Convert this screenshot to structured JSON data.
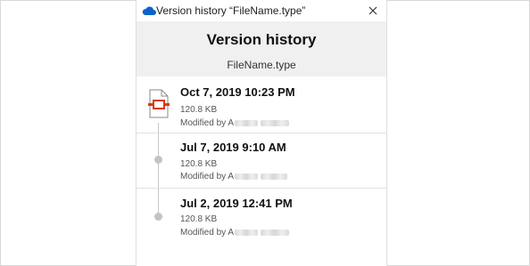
{
  "window": {
    "title": "Version history “FileName.type”",
    "close_glyph": "✕"
  },
  "header": {
    "title": "Version history",
    "filename": "FileName.type"
  },
  "versions": [
    {
      "date": "Oct 7, 2019 10:23 PM",
      "size": "120.8 KB",
      "modified_prefix": "Modified by A",
      "icon": "file-icon",
      "current": true
    },
    {
      "date": "Jul 7, 2019 9:10 AM",
      "size": "120.8 KB",
      "modified_prefix": "Modified by A",
      "icon": "timeline-dot-icon",
      "current": false
    },
    {
      "date": "Jul 2, 2019 12:41 PM",
      "size": "120.8 KB",
      "modified_prefix": "Modified by A",
      "icon": "timeline-dot-icon",
      "current": false
    }
  ],
  "colors": {
    "onedrive_blue": "#0a64c8",
    "file_icon_red": "#d83b01",
    "header_bg": "#f0f0f0"
  }
}
